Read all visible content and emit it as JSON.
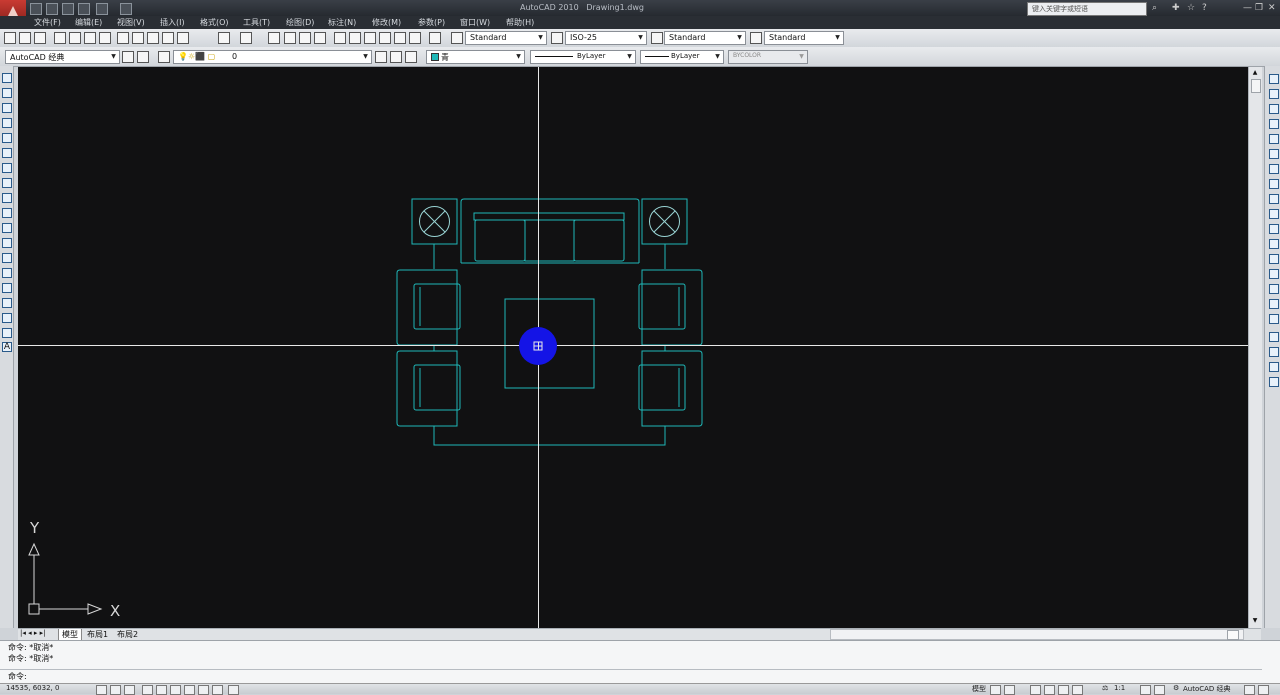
{
  "title_bar": {
    "app_name": "AutoCAD 2010",
    "document": "Drawing1.dwg",
    "search_placeholder": "键入关键字或短语"
  },
  "menu": [
    "文件(F)",
    "编辑(E)",
    "视图(V)",
    "插入(I)",
    "格式(O)",
    "工具(T)",
    "绘图(D)",
    "标注(N)",
    "修改(M)",
    "参数(P)",
    "窗口(W)",
    "帮助(H)"
  ],
  "styles_toolbar": {
    "text_style": "Standard",
    "dim_style": "ISO-25",
    "table_style": "Standard",
    "multileader_style": "Standard"
  },
  "layers_toolbar": {
    "workspace": "AutoCAD 经典",
    "layer": "0",
    "color": "青",
    "linetype": "ByLayer",
    "lineweight": "ByLayer",
    "plotstyle": "BYCOLOR"
  },
  "ucs": {
    "x_label": "X",
    "y_label": "Y"
  },
  "tabs": [
    "模型",
    "布局1",
    "布局2"
  ],
  "command_history": [
    "命令: *取消*",
    "命令: *取消*"
  ],
  "command_prompt": "命令:",
  "status": {
    "coordinates": "14535, 6032, 0",
    "model_label": "模型",
    "annotation_scale": "1:1",
    "workspace_label": "AutoCAD 经典"
  },
  "colors": {
    "canvas": "#111112",
    "drawing": "#1fb8b8",
    "crosshair": "#e8e8e8",
    "cursor_highlight": "#1414e6"
  }
}
